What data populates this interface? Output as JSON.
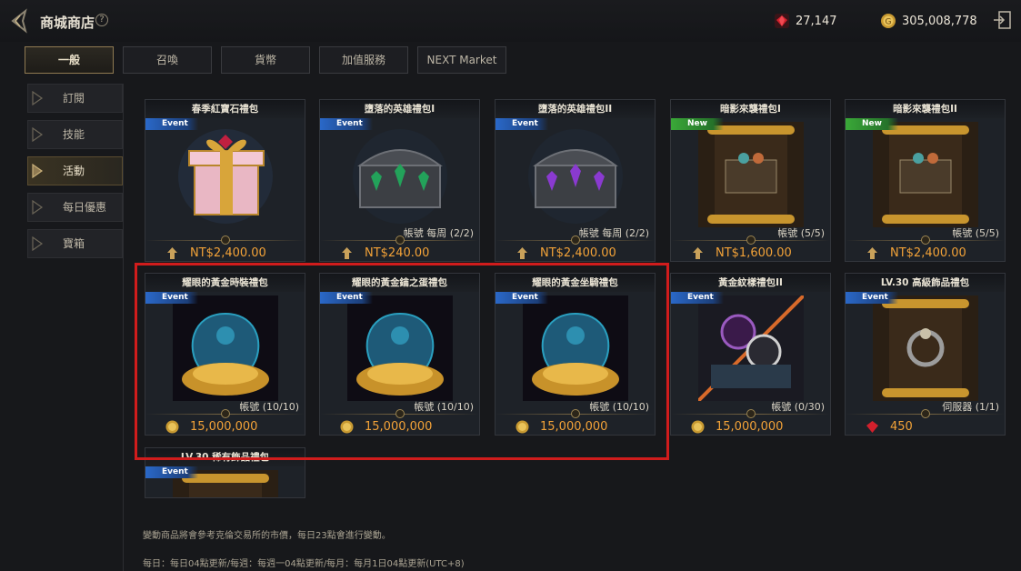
{
  "header": {
    "title": "商城商店",
    "help_icon": "question-icon",
    "ruby_amount": "27,147",
    "coin_amount": "305,008,778"
  },
  "tabs": [
    {
      "label": "一般"
    },
    {
      "label": "召喚"
    },
    {
      "label": "貨幣"
    },
    {
      "label": "加值服務"
    },
    {
      "label": "NEXT Market"
    }
  ],
  "sidebar": {
    "items": [
      {
        "label": "訂閱"
      },
      {
        "label": "技能"
      },
      {
        "label": "活動"
      },
      {
        "label": "每日優惠"
      },
      {
        "label": "寶箱"
      }
    ]
  },
  "products": [
    {
      "title": "春季紅寶石禮包",
      "badge": "Event",
      "limit": "",
      "price": "NT$2,400.00",
      "price_icon": "buy-icon"
    },
    {
      "title": "墮落的英雄禮包I",
      "badge": "Event",
      "limit": "帳號 每周 (2/2)",
      "price": "NT$240.00",
      "price_icon": "buy-icon"
    },
    {
      "title": "墮落的英雄禮包II",
      "badge": "Event",
      "limit": "帳號 每周 (2/2)",
      "price": "NT$2,400.00",
      "price_icon": "buy-icon"
    },
    {
      "title": "暗影來襲禮包I",
      "badge": "New",
      "limit": "帳號 (5/5)",
      "price": "NT$1,600.00",
      "price_icon": "buy-icon"
    },
    {
      "title": "暗影來襲禮包II",
      "badge": "New",
      "limit": "帳號 (5/5)",
      "price": "NT$2,400.00",
      "price_icon": "buy-icon"
    },
    {
      "title": "耀眼的黃金時裝禮包",
      "badge": "Event",
      "limit": "帳號 (10/10)",
      "price": "15,000,000",
      "price_icon": "coin-icon"
    },
    {
      "title": "耀眼的黃金鑰之蛋禮包",
      "badge": "Event",
      "limit": "帳號 (10/10)",
      "price": "15,000,000",
      "price_icon": "coin-icon"
    },
    {
      "title": "耀眼的黃金坐騎禮包",
      "badge": "Event",
      "limit": "帳號 (10/10)",
      "price": "15,000,000",
      "price_icon": "coin-icon"
    },
    {
      "title": "黃金紋樣禮包II",
      "badge": "Event",
      "limit": "帳號 (0/30)",
      "price": "15,000,000",
      "price_icon": "coin-icon"
    },
    {
      "title": "LV.30 高級飾品禮包",
      "badge": "Event",
      "limit": "伺服器 (1/1)",
      "price": "450",
      "price_icon": "ruby-icon"
    },
    {
      "title": "LV.30 稀有飾品禮包",
      "badge": "Event",
      "limit": "",
      "price": "",
      "price_icon": ""
    }
  ],
  "notes": {
    "line1": "變動商品將會參考克倫交易所的市價，每日23點會進行變動。",
    "line2": "每日：每日04點更新/每週：每週一04點更新/每月：每月1日04點更新(UTC+8)"
  },
  "colors": {
    "price": "#f2a238",
    "event_badge": "#2a68c8",
    "new_badge": "#3aa838",
    "highlight": "#d01c1c"
  }
}
